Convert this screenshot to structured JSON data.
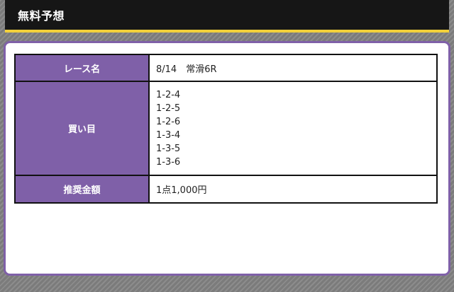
{
  "header": {
    "title": "無料予想"
  },
  "table": {
    "race_label": "レース名",
    "race_value": "8/14　常滑6R",
    "bets_label": "買い目",
    "bets": [
      "1-2-4",
      "1-2-5",
      "1-2-6",
      "1-3-4",
      "1-3-5",
      "1-3-6"
    ],
    "amount_label": "推奨金額",
    "amount_value": "1点1,000円"
  },
  "colors": {
    "header_bg": "#161616",
    "header_accent": "#f2d13a",
    "label_bg": "#7f60a8",
    "panel_border": "#7f60a8"
  }
}
